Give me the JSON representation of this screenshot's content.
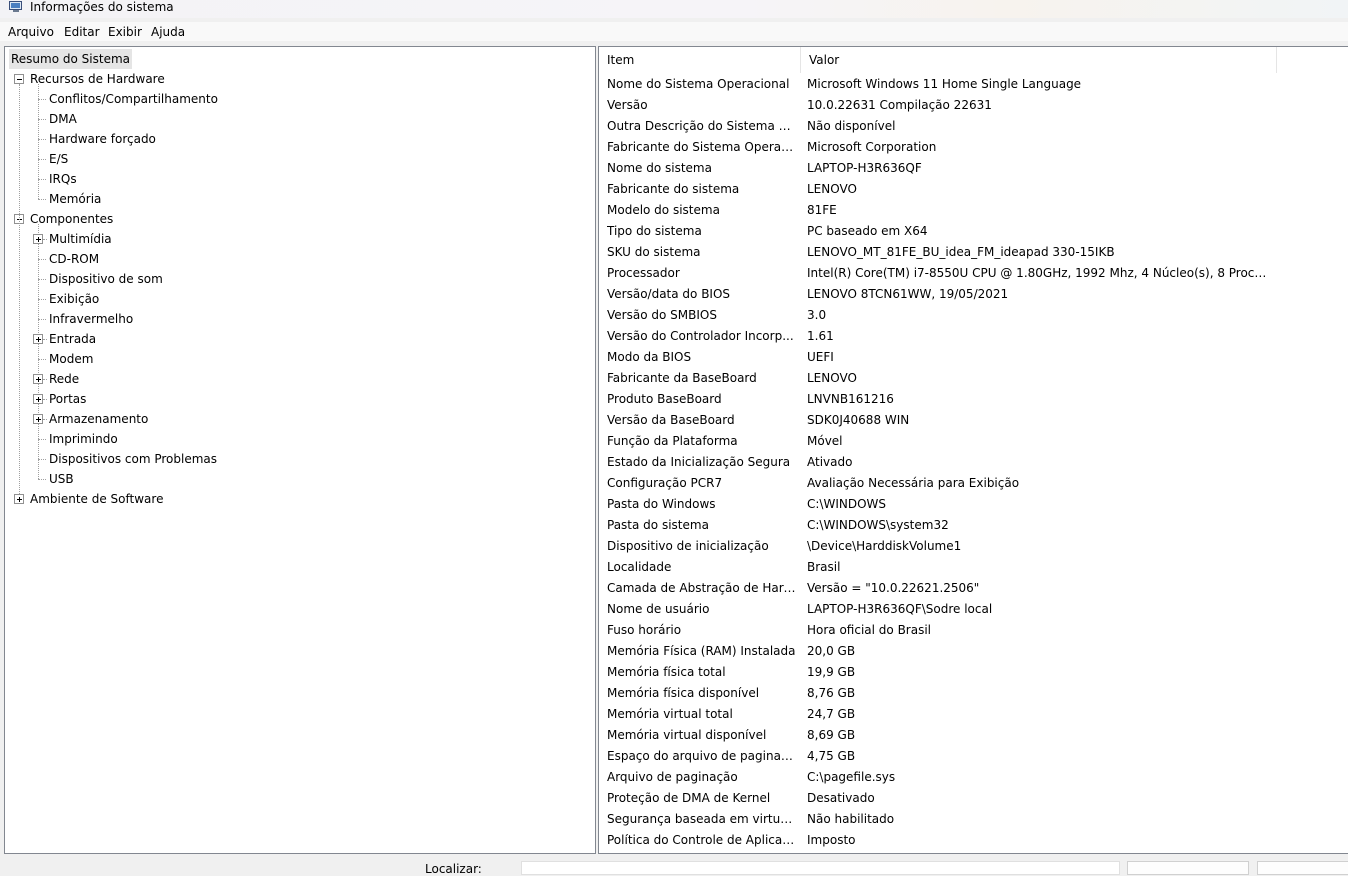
{
  "window": {
    "title": "Informações do sistema"
  },
  "menu": [
    "Arquivo",
    "Editar",
    "Exibir",
    "Ajuda"
  ],
  "tree": {
    "root": "Resumo do Sistema",
    "hardware": "Recursos de Hardware",
    "hardware_items": [
      "Conflitos/Compartilhamento",
      "DMA",
      "Hardware forçado",
      "E/S",
      "IRQs",
      "Memória"
    ],
    "components": "Componentes",
    "component_items": [
      "Multimídia",
      "CD-ROM",
      "Dispositivo de som",
      "Exibição",
      "Infravermelho",
      "Entrada",
      "Modem",
      "Rede",
      "Portas",
      "Armazenamento",
      "Imprimindo",
      "Dispositivos com Problemas",
      "USB"
    ],
    "software": "Ambiente de Software"
  },
  "list": {
    "headers": {
      "item": "Item",
      "value": "Valor"
    },
    "rows": [
      [
        "Nome do Sistema Operacional",
        "Microsoft Windows 11 Home Single Language"
      ],
      [
        "Versão",
        "10.0.22631 Compilação 22631"
      ],
      [
        "Outra Descrição do Sistema O...",
        "Não disponível"
      ],
      [
        "Fabricante do Sistema Operaci...",
        "Microsoft Corporation"
      ],
      [
        "Nome do sistema",
        "LAPTOP-H3R636QF"
      ],
      [
        "Fabricante do sistema",
        "LENOVO"
      ],
      [
        "Modelo do sistema",
        "81FE"
      ],
      [
        "Tipo do sistema",
        "PC baseado em X64"
      ],
      [
        "SKU do sistema",
        "LENOVO_MT_81FE_BU_idea_FM_ideapad 330-15IKB"
      ],
      [
        "Processador",
        "Intel(R) Core(TM) i7-8550U CPU @ 1.80GHz, 1992 Mhz, 4 Núcleo(s), 8 Process..."
      ],
      [
        "Versão/data do BIOS",
        "LENOVO 8TCN61WW, 19/05/2021"
      ],
      [
        "Versão do SMBIOS",
        "3.0"
      ],
      [
        "Versão do Controlador Incorp...",
        "1.61"
      ],
      [
        "Modo da BIOS",
        "UEFI"
      ],
      [
        "Fabricante da BaseBoard",
        "LENOVO"
      ],
      [
        "Produto BaseBoard",
        "LNVNB161216"
      ],
      [
        "Versão da BaseBoard",
        "SDK0J40688 WIN"
      ],
      [
        "Função da Plataforma",
        "Móvel"
      ],
      [
        "Estado da Inicialização Segura",
        "Ativado"
      ],
      [
        "Configuração PCR7",
        "Avaliação Necessária para Exibição"
      ],
      [
        "Pasta do Windows",
        "C:\\WINDOWS"
      ],
      [
        "Pasta do sistema",
        "C:\\WINDOWS\\system32"
      ],
      [
        "Dispositivo de inicialização",
        "\\Device\\HarddiskVolume1"
      ],
      [
        "Localidade",
        "Brasil"
      ],
      [
        "Camada de Abstração de Hard...",
        "Versão = \"10.0.22621.2506\""
      ],
      [
        "Nome de usuário",
        "LAPTOP-H3R636QF\\Sodre local"
      ],
      [
        "Fuso horário",
        "Hora oficial do Brasil"
      ],
      [
        "Memória Física (RAM) Instalada",
        "20,0 GB"
      ],
      [
        "Memória física total",
        "19,9 GB"
      ],
      [
        "Memória física disponível",
        "8,76 GB"
      ],
      [
        "Memória virtual total",
        "24,7 GB"
      ],
      [
        "Memória virtual disponível",
        "8,69 GB"
      ],
      [
        "Espaço do arquivo de paginaç...",
        "4,75 GB"
      ],
      [
        "Arquivo de paginação",
        "C:\\pagefile.sys"
      ],
      [
        "Proteção de DMA de Kernel",
        "Desativado"
      ],
      [
        "Segurança baseada em virtuali...",
        "Não habilitado"
      ],
      [
        "Política do Controle de Aplicati...",
        "Imposto"
      ]
    ]
  },
  "find": {
    "label": "Localizar:"
  },
  "icons": {
    "app": "system-info-icon",
    "expand": "plus-icon",
    "collapse": "minus-icon"
  }
}
